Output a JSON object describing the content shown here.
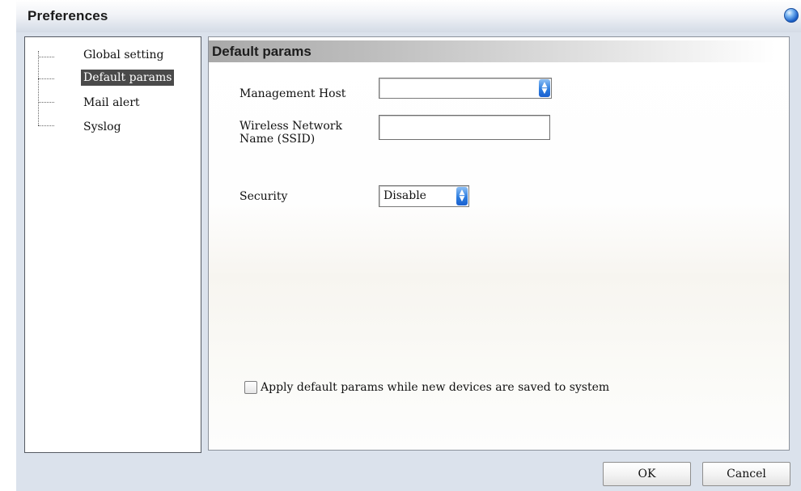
{
  "window": {
    "title": "Preferences",
    "title_icon": "globe-icon"
  },
  "tree": {
    "items": [
      {
        "label": "Global setting",
        "selected": false
      },
      {
        "label": "Default params",
        "selected": true
      },
      {
        "label": "Mail alert",
        "selected": false
      },
      {
        "label": "Syslog",
        "selected": false
      }
    ]
  },
  "section": {
    "title": "Default params"
  },
  "form": {
    "management_host": {
      "label": "Management Host",
      "value": ""
    },
    "ssid": {
      "label_line1": "Wireless Network",
      "label_line2": "Name (SSID)",
      "value": ""
    },
    "security": {
      "label": "Security",
      "value": "Disable"
    },
    "apply_checkbox": {
      "label": "Apply default params while new devices are saved to system",
      "checked": false
    }
  },
  "buttons": {
    "ok": "OK",
    "cancel": "Cancel"
  },
  "colors": {
    "selected_item_bg": "#4a4a4a",
    "stepper_accent": "#2e7ee0",
    "frame_bg": "#dbe2ec"
  }
}
